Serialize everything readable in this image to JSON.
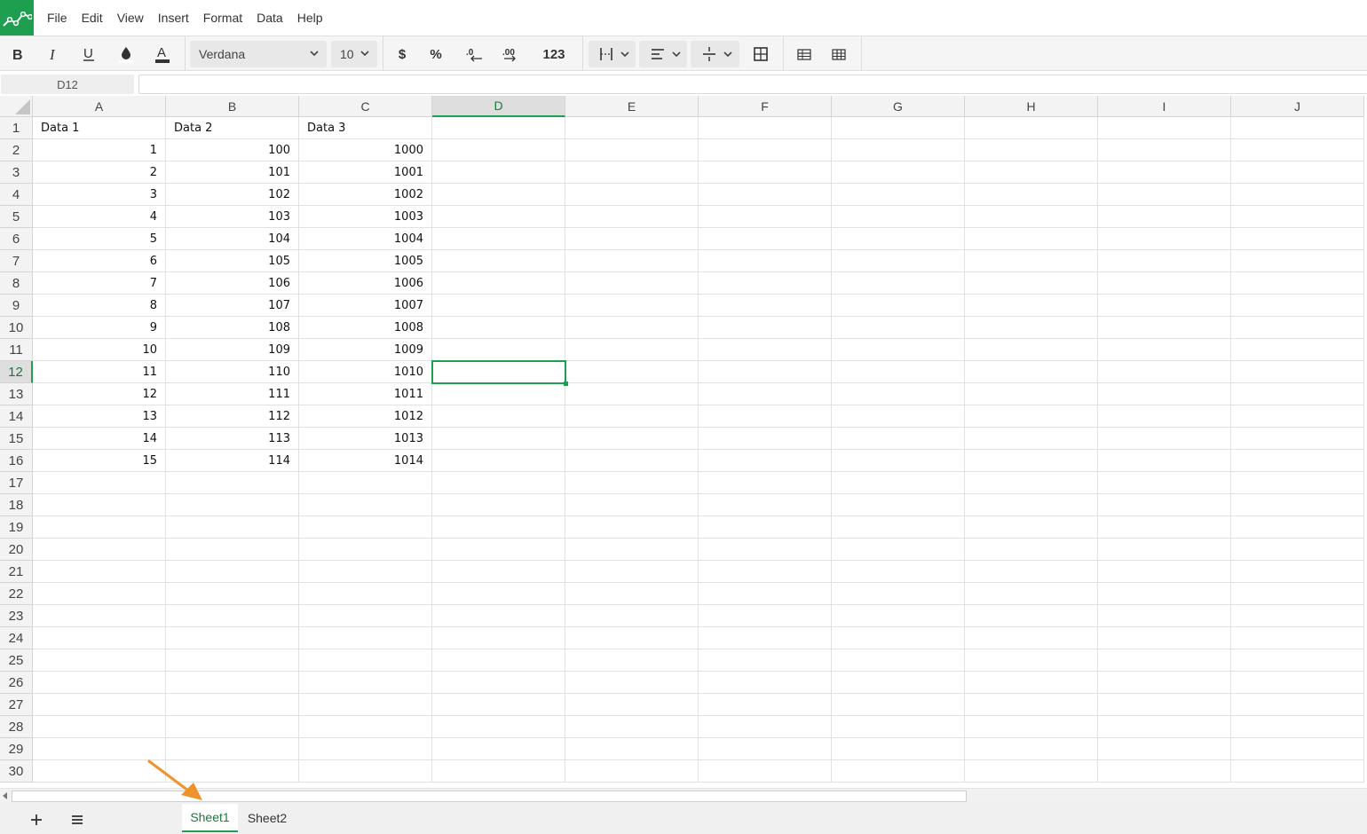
{
  "menu": [
    "File",
    "Edit",
    "View",
    "Insert",
    "Format",
    "Data",
    "Help"
  ],
  "toolbar": {
    "font_family": "Verdana",
    "font_size": "10",
    "currency_symbol": "$",
    "percent_symbol": "%",
    "number_format": "123"
  },
  "formula_bar": {
    "cell_reference": "D12",
    "formula": ""
  },
  "columns": [
    "A",
    "B",
    "C",
    "D",
    "E",
    "F",
    "G",
    "H",
    "I",
    "J"
  ],
  "selected_column": "D",
  "selected_row": 12,
  "row_count": 30,
  "headers": [
    "Data 1",
    "Data 2",
    "Data 3"
  ],
  "rows": [
    [
      "1",
      "100",
      "1000"
    ],
    [
      "2",
      "101",
      "1001"
    ],
    [
      "3",
      "102",
      "1002"
    ],
    [
      "4",
      "103",
      "1003"
    ],
    [
      "5",
      "104",
      "1004"
    ],
    [
      "6",
      "105",
      "1005"
    ],
    [
      "7",
      "106",
      "1006"
    ],
    [
      "8",
      "107",
      "1007"
    ],
    [
      "9",
      "108",
      "1008"
    ],
    [
      "10",
      "109",
      "1009"
    ],
    [
      "11",
      "110",
      "1010"
    ],
    [
      "12",
      "111",
      "1011"
    ],
    [
      "13",
      "112",
      "1012"
    ],
    [
      "14",
      "113",
      "1013"
    ],
    [
      "15",
      "114",
      "1014"
    ]
  ],
  "sheets": [
    "Sheet1",
    "Sheet2"
  ],
  "active_sheet": "Sheet1",
  "colors": {
    "accent": "#1e9f4f",
    "annotation_arrow": "#f0922b"
  }
}
